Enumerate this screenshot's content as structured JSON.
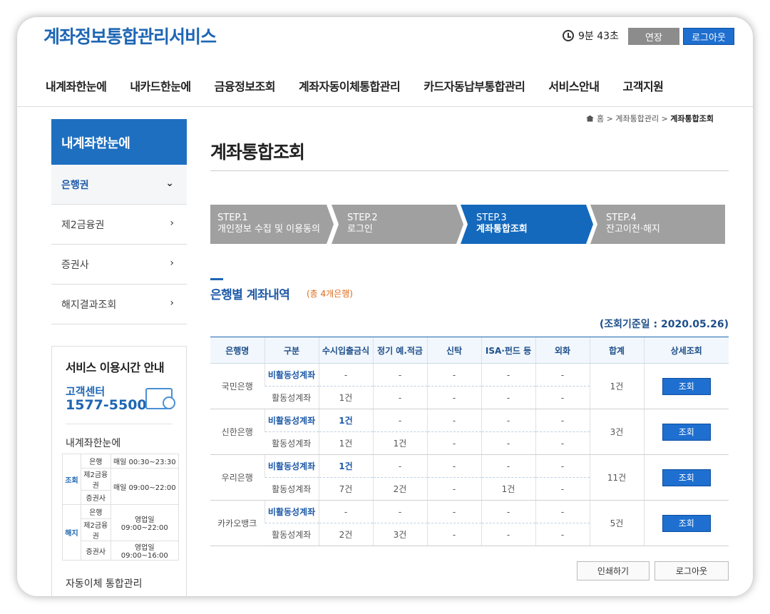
{
  "header": {
    "logo": "계좌정보통합관리서비스",
    "timer": "9분 43초",
    "extend_label": "연장",
    "logout_label": "로그아웃"
  },
  "gnb": [
    "내계좌한눈에",
    "내카드한눈에",
    "금융정보조회",
    "계좌자동이체통합관리",
    "카드자동납부통합관리",
    "서비스안내",
    "고객지원"
  ],
  "sidebar": {
    "title": "내계좌한눈에",
    "items": [
      {
        "label": "은행권",
        "arrow": "⌄"
      },
      {
        "label": "제2금융권",
        "arrow": "›"
      },
      {
        "label": "증권사",
        "arrow": "›"
      },
      {
        "label": "해지결과조회",
        "arrow": "›"
      }
    ]
  },
  "service_box": {
    "title": "서비스 이용시간 안내",
    "center_label": "고객센터",
    "phone": "1577-5500",
    "sub_title": "내계좌한눈에",
    "rows": [
      {
        "cat": "조회",
        "inst": "은행",
        "time": "매일 00:30~23:30"
      },
      {
        "cat": "",
        "inst": "제2금융권",
        "time": "매일 09:00~22:00"
      },
      {
        "cat": "",
        "inst": "증권사",
        "time": ""
      },
      {
        "cat": "해지",
        "inst": "은행",
        "time": "영업일 09:00~22:00"
      },
      {
        "cat": "",
        "inst": "제2금융권",
        "time": ""
      },
      {
        "cat": "",
        "inst": "증권사",
        "time": "영업일 09:00~16:00"
      }
    ],
    "bottom_label": "자동이체 통합관리"
  },
  "breadcrumb": {
    "home": "홈",
    "level1": "계좌통합관리",
    "current": "계좌통합조회"
  },
  "page_title": "계좌통합조회",
  "steps": [
    {
      "num": "STEP.1",
      "label": "개인정보 수집 및 이용동의"
    },
    {
      "num": "STEP.2",
      "label": "로그인"
    },
    {
      "num": "STEP.3",
      "label": "계좌통합조회"
    },
    {
      "num": "STEP.4",
      "label": "잔고이전·해지"
    }
  ],
  "section": {
    "title": "은행별 계좌내역",
    "count": "(총 4개은행)",
    "ref_date": "(조회기준일 : 2020.05.26)"
  },
  "table": {
    "headers": [
      "은행명",
      "구분",
      "수시입출금식",
      "정기 예.적금",
      "신탁",
      "ISA·펀드 등",
      "외화",
      "합계",
      "상세조회"
    ],
    "view_label": "조회",
    "banks": [
      {
        "name": "국민은행",
        "total": "1건",
        "rows": [
          {
            "type": "비활동성계좌",
            "cells": [
              "-",
              "-",
              "-",
              "-",
              "-"
            ]
          },
          {
            "type": "활동성계좌",
            "cells": [
              "1건",
              "-",
              "-",
              "-",
              "-"
            ]
          }
        ]
      },
      {
        "name": "신한은행",
        "total": "3건",
        "rows": [
          {
            "type": "비활동성계좌",
            "cells": [
              "1건",
              "-",
              "-",
              "-",
              "-"
            ]
          },
          {
            "type": "활동성계좌",
            "cells": [
              "1건",
              "1건",
              "-",
              "-",
              "-"
            ]
          }
        ]
      },
      {
        "name": "우리은행",
        "total": "11건",
        "rows": [
          {
            "type": "비활동성계좌",
            "cells": [
              "1건",
              "-",
              "-",
              "-",
              "-"
            ]
          },
          {
            "type": "활동성계좌",
            "cells": [
              "7건",
              "2건",
              "-",
              "1건",
              "-"
            ]
          }
        ]
      },
      {
        "name": "카카오뱅크",
        "total": "5건",
        "rows": [
          {
            "type": "비활동성계좌",
            "cells": [
              "-",
              "-",
              "-",
              "-",
              "-"
            ]
          },
          {
            "type": "활동성계좌",
            "cells": [
              "2건",
              "3건",
              "-",
              "-",
              "-"
            ]
          }
        ]
      }
    ]
  },
  "footer_buttons": {
    "print": "인쇄하기",
    "logout": "로그아웃"
  }
}
